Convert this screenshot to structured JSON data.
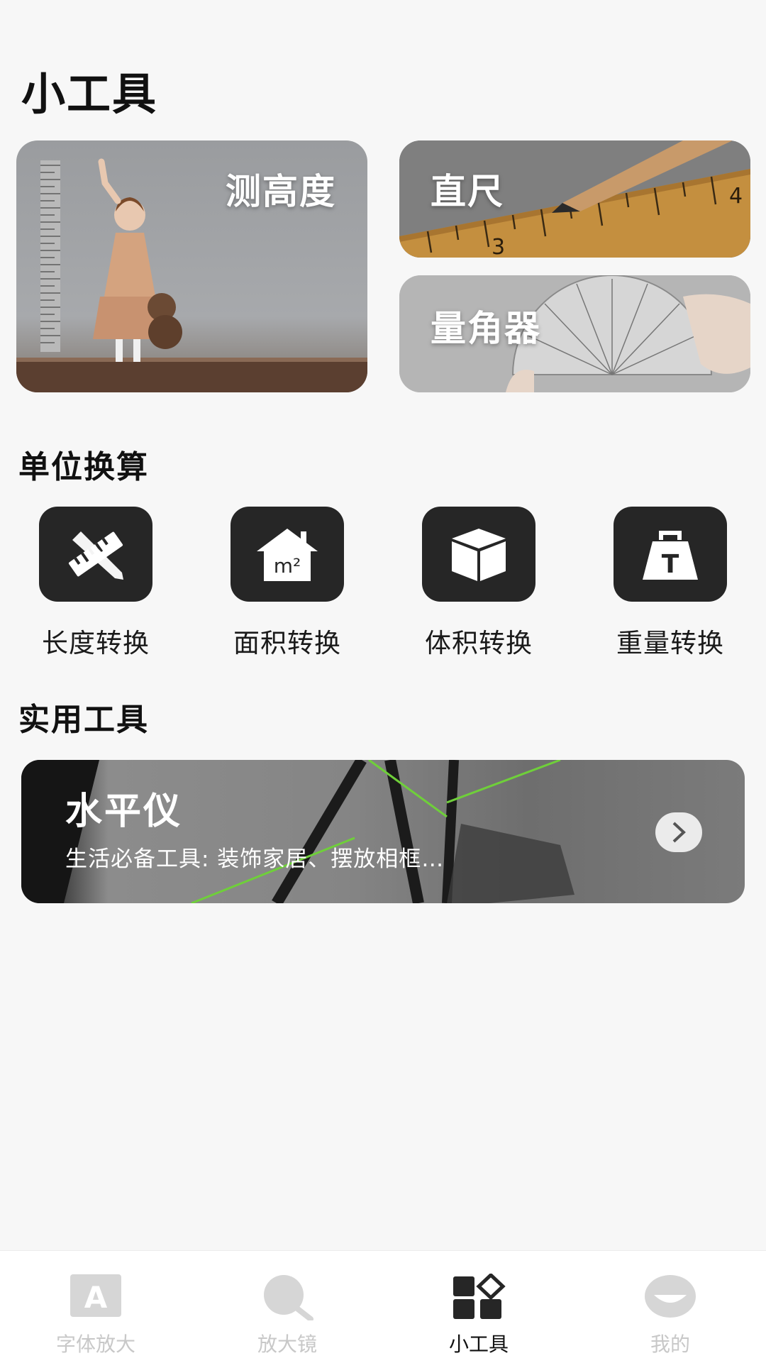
{
  "page": {
    "title": "小工具"
  },
  "feature_cards": {
    "height": "测高度",
    "ruler": "直尺",
    "protractor": "量角器"
  },
  "unit_section": {
    "title": "单位换算",
    "items": [
      {
        "label": "长度转换",
        "icon": "ruler-pencil-icon"
      },
      {
        "label": "面积转换",
        "icon": "area-house-icon",
        "icon_text": "m²"
      },
      {
        "label": "体积转换",
        "icon": "cube-icon"
      },
      {
        "label": "重量转换",
        "icon": "weight-icon",
        "icon_text": "T"
      }
    ]
  },
  "tools_section": {
    "title": "实用工具",
    "banner": {
      "title": "水平仪",
      "subtitle": "生活必备工具: 装饰家居、摆放相框…"
    }
  },
  "bottom_nav": {
    "items": [
      {
        "label": "字体放大",
        "icon": "font-a-icon",
        "icon_text": "A",
        "active": false
      },
      {
        "label": "放大镜",
        "icon": "magnifier-icon",
        "active": false
      },
      {
        "label": "小工具",
        "icon": "tools-grid-icon",
        "active": true
      },
      {
        "label": "我的",
        "icon": "profile-icon",
        "active": false
      }
    ]
  },
  "colors": {
    "accent_dark": "#262626",
    "inactive": "#c8c8c8",
    "background": "#f7f7f7"
  }
}
